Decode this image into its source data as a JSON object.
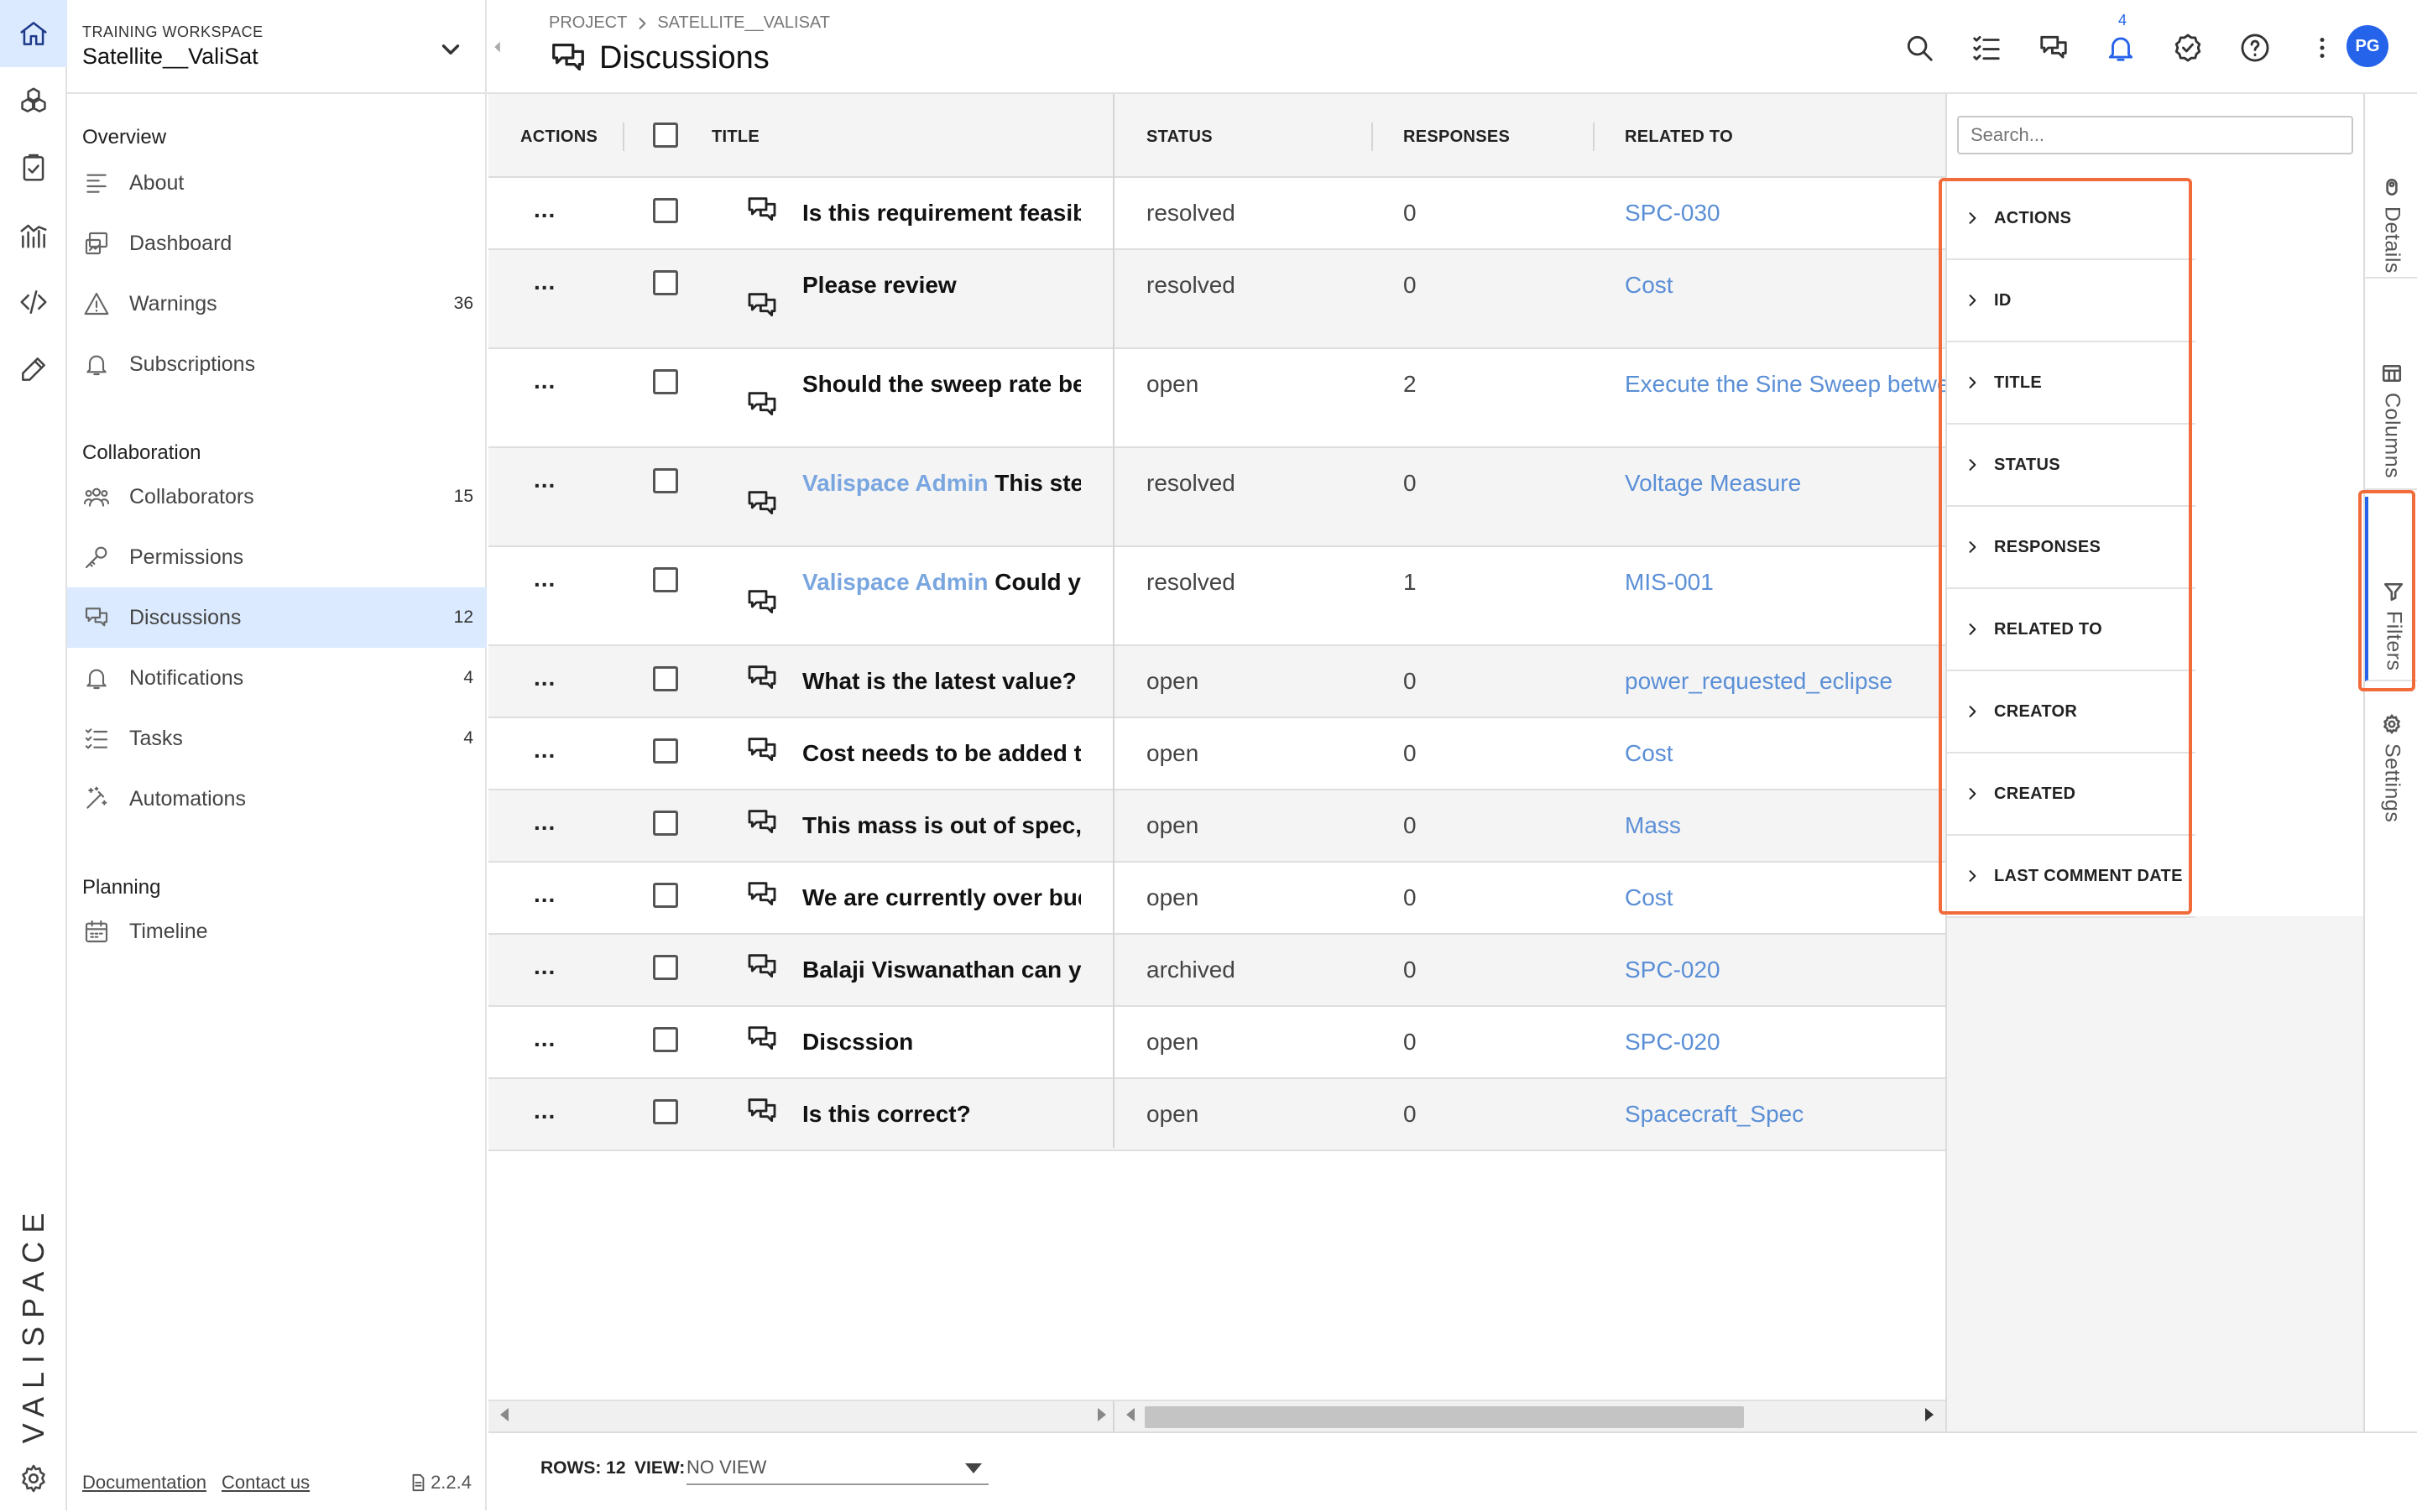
{
  "workspace": {
    "label": "TRAINING WORKSPACE",
    "name": "Satellite__ValiSat"
  },
  "rail": {
    "logo": "VALISPACE"
  },
  "sidebar": {
    "sections": [
      {
        "title": "Overview",
        "items": [
          {
            "label": "About",
            "count": "",
            "icon": "about-lines-icon"
          },
          {
            "label": "Dashboard",
            "count": "",
            "icon": "dashboard-icon"
          },
          {
            "label": "Warnings",
            "count": "36",
            "icon": "warning-triangle-icon"
          },
          {
            "label": "Subscriptions",
            "count": "",
            "icon": "bell-icon"
          }
        ]
      },
      {
        "title": "Collaboration",
        "items": [
          {
            "label": "Collaborators",
            "count": "15",
            "icon": "people-icon"
          },
          {
            "label": "Permissions",
            "count": "",
            "icon": "key-icon"
          },
          {
            "label": "Discussions",
            "count": "12",
            "icon": "chat-bubbles-icon",
            "active": true
          },
          {
            "label": "Notifications",
            "count": "4",
            "icon": "bell-icon"
          },
          {
            "label": "Tasks",
            "count": "4",
            "icon": "task-list-icon"
          },
          {
            "label": "Automations",
            "count": "",
            "icon": "magic-wand-icon"
          }
        ]
      },
      {
        "title": "Planning",
        "items": [
          {
            "label": "Timeline",
            "count": "",
            "icon": "calendar-icon"
          }
        ]
      }
    ],
    "footer": {
      "documentation": "Documentation",
      "contact": "Contact us",
      "version": "2.2.4"
    }
  },
  "topbar": {
    "breadcrumb_root": "PROJECT",
    "breadcrumb_project": "SATELLITE__VALISAT",
    "title": "Discussions",
    "notification_badge": "4",
    "avatar_initials": "PG"
  },
  "table": {
    "headers": {
      "actions": "ACTIONS",
      "title": "TITLE",
      "status": "STATUS",
      "responses": "RESPONSES",
      "related": "RELATED TO"
    },
    "rows": [
      {
        "actions": "...",
        "mention": "",
        "title": "Is this requirement feasible",
        "status": "resolved",
        "responses": "0",
        "related": "SPC-030"
      },
      {
        "actions": "...",
        "mention": "",
        "title": "Please review",
        "status": "resolved",
        "responses": "0",
        "related": "Cost"
      },
      {
        "actions": "...",
        "mention": "",
        "title": "Should the sweep rate be h",
        "status": "open",
        "responses": "2",
        "related": "Execute the Sine Sweep betwe"
      },
      {
        "actions": "...",
        "mention": "Valispace Admin",
        "title": " This step",
        "status": "resolved",
        "responses": "0",
        "related": "Voltage Measure"
      },
      {
        "actions": "...",
        "mention": "Valispace Admin",
        "title": " Could you",
        "status": "resolved",
        "responses": "1",
        "related": "MIS-001"
      },
      {
        "actions": "...",
        "mention": "",
        "title": "What is the latest value?",
        "status": "open",
        "responses": "0",
        "related": "power_requested_eclipse"
      },
      {
        "actions": "...",
        "mention": "",
        "title": "Cost needs to be added to",
        "status": "open",
        "responses": "0",
        "related": "Cost"
      },
      {
        "actions": "...",
        "mention": "",
        "title": "This mass is out of spec, n",
        "status": "open",
        "responses": "0",
        "related": "Mass"
      },
      {
        "actions": "...",
        "mention": "",
        "title": "We are currently over budg",
        "status": "open",
        "responses": "0",
        "related": "Cost"
      },
      {
        "actions": "...",
        "mention": "",
        "title": "Balaji Viswanathan can you",
        "status": "archived",
        "responses": "0",
        "related": "SPC-020"
      },
      {
        "actions": "...",
        "mention": "",
        "title": "Discssion",
        "status": "open",
        "responses": "0",
        "related": "SPC-020"
      },
      {
        "actions": "...",
        "mention": "",
        "title": "Is this correct?",
        "status": "open",
        "responses": "0",
        "related": "Spacecraft_Spec"
      }
    ]
  },
  "filters": {
    "search_placeholder": "Search...",
    "items": [
      "ACTIONS",
      "ID",
      "TITLE",
      "STATUS",
      "RESPONSES",
      "RELATED TO",
      "CREATOR",
      "CREATED",
      "LAST COMMENT DATE"
    ]
  },
  "side_tabs": {
    "details": "Details",
    "columns": "Columns",
    "filters": "Filters",
    "settings": "Settings"
  },
  "footer": {
    "rows_label": "ROWS: 12",
    "view_label": "VIEW:",
    "view_value": "NO VIEW"
  },
  "colors": {
    "accent": "#2563eb",
    "highlight": "#f26b3a",
    "active_bg": "#dbeafe",
    "link": "#5b8fd6"
  }
}
